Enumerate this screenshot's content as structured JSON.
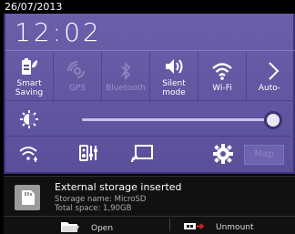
{
  "status": {
    "date": "26/07/2013"
  },
  "clock": {
    "time": "12:02"
  },
  "quick_settings": [
    {
      "label": "Smart\nSaving",
      "icon": "smart-saving-icon",
      "state": "on"
    },
    {
      "label": "GPS",
      "icon": "gps-icon",
      "state": "off"
    },
    {
      "label": "Bluetooth",
      "icon": "bluetooth-icon",
      "state": "off"
    },
    {
      "label": "Silent mode",
      "icon": "silent-mode-icon",
      "state": "on"
    },
    {
      "label": "Wi-Fi",
      "icon": "wifi-icon",
      "state": "on"
    },
    {
      "label": "Auto-",
      "icon": "auto-rotate-icon",
      "state": "on"
    }
  ],
  "brightness": {
    "level_fraction": 0.95
  },
  "tools": {
    "map_label": "Map"
  },
  "notification": {
    "title": "External storage inserted",
    "line1": "Storage name: MicroSD",
    "line2": "Total space: 1,90GB",
    "open_label": "Open",
    "unmount_label": "Unmount"
  }
}
